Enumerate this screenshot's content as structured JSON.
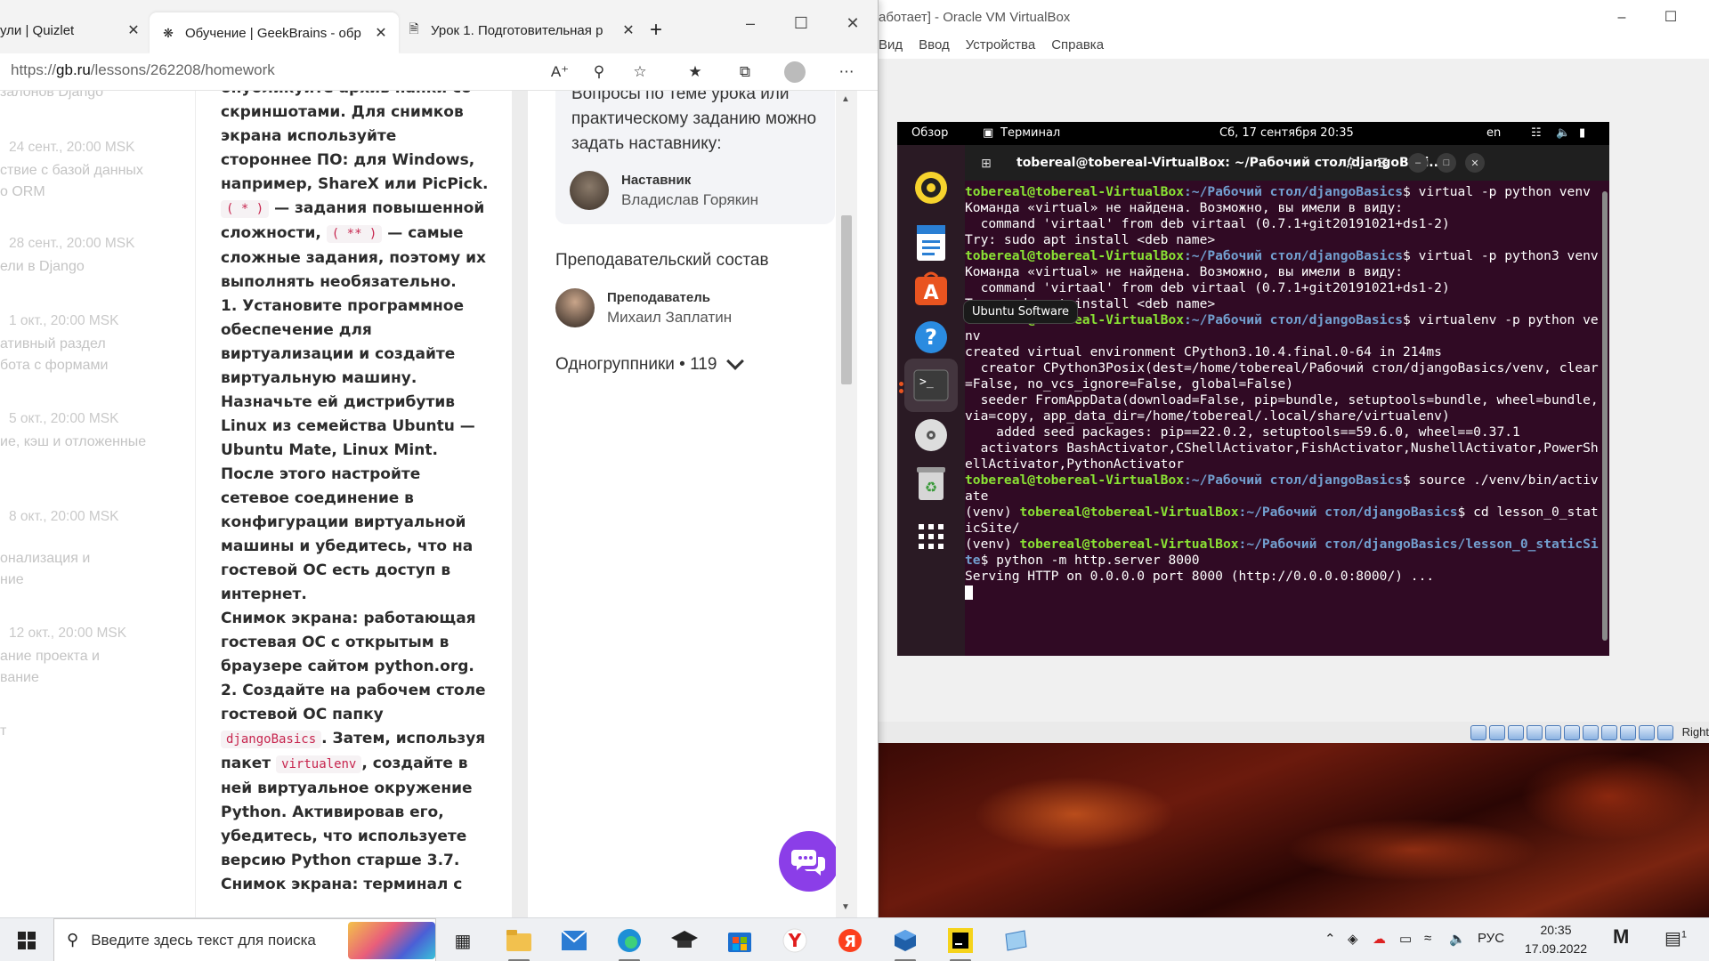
{
  "browser": {
    "tabs": [
      {
        "label": "ули | Quizlet",
        "icon": "quizlet-icon"
      },
      {
        "label": "Обучение | GeekBrains - обр",
        "icon": "openai-like-icon",
        "active": true
      },
      {
        "label": "Урок 1. Подготовительная р",
        "icon": "page-icon"
      }
    ],
    "url_prefix": "https://",
    "url_domain": "gb.ru",
    "url_path": "/lessons/262208/homework"
  },
  "timeline": {
    "top_partial": "залонов Django",
    "items": [
      {
        "date": "24 сент., 20:00 MSK",
        "text": "ствие с базой данных\nо ORM"
      },
      {
        "date": "28 сент., 20:00 MSK",
        "text": "ели в Django"
      },
      {
        "date": "1 окт., 20:00 MSK",
        "text": "ативный раздел\nбота с формами"
      },
      {
        "date": "5 окт., 20:00 MSK",
        "text": "ие, кэш и отложенные"
      },
      {
        "date": "8 окт., 20:00 MSK",
        "text": "онализация и\nние"
      },
      {
        "date": "12 окт., 20:00 MSK",
        "text": "ание проекта и\nвание"
      },
      {
        "date": "",
        "text": "т"
      }
    ]
  },
  "homework": {
    "p1": "опубликуйте архив папки со скриншотами. Для снимков экрана используйте стороннее ПО: для Windows, например, ShareX или PicPick.",
    "code_star": "( * )",
    "p2a": " — задания повышенной сложности, ",
    "code_dstar": "( ** )",
    "p2b": " — самые сложные задания, поэтому их выполнять необязательно.",
    "p3": "1. Установите программное обеспечение для виртуализации и создайте виртуальную машину. Назначьте ей дистрибутив Linux из семейства Ubuntu — Ubuntu Mate, Linux Mint. После этого настройте сетевое соединение в конфигурации виртуальной машины и убедитесь, что на гостевой ОС есть доступ в интернет.",
    "p4": "Снимок экрана: работающая гостевая ОС с открытым в браузере сайтом python.org.",
    "p5a": "2. Создайте на рабочем столе гостевой ОС папку ",
    "code_folder": "djangoBasics",
    "p5b": ". Затем, используя пакет ",
    "code_venv": "virtualenv",
    "p5c": ", создайте в ней виртуальное окружение Python. Активировав его, убедитесь, что используете версию Python старше 3.7.",
    "p6": "Снимок экрана: терминал с"
  },
  "sidebar": {
    "ask_text": "Вопросы по теме урока или практическому заданию можно задать наставнику:",
    "mentor_role": "Наставник",
    "mentor_name": "Владислав Горякин",
    "staff_title": "Преподавательский состав",
    "teacher_role": "Преподаватель",
    "teacher_name": "Михаил Заплатин",
    "group_label": "Одногруппники • 119"
  },
  "vbox": {
    "title": "аботает] - Oracle VM VirtualBox",
    "menu": [
      "Вид",
      "Ввод",
      "Устройства",
      "Справка"
    ],
    "status_key": "Right"
  },
  "ubuntu": {
    "overview": "Обзор",
    "app_name": "Терминал",
    "datetime": "Сб, 17 сентября  20:35",
    "lang": "en",
    "dock_tooltip": "Ubuntu Software",
    "term_title": "tobereal@tobereal-VirtualBox: ~/Рабочий стол/djangoBasi...",
    "lines": [
      {
        "user": "tobereal@tobereal-VirtualBox",
        "path": ":~/Рабочий стол/djangoBasics",
        "cmd": "$ virtual -p python venv"
      },
      {
        "text": "Команда «virtual» не найдена. Возможно, вы имели в виду:"
      },
      {
        "text": "  command 'virtaal' from deb virtaal (0.7.1+git20191021+ds1-2)"
      },
      {
        "text": "Try: sudo apt install <deb name>"
      },
      {
        "user": "tobereal@tobereal-VirtualBox",
        "path": ":~/Рабочий стол/djangoBasics",
        "cmd": "$ virtual -p python3 venv"
      },
      {
        "text": "Команда «virtual» не найдена. Возможно, вы имели в виду:"
      },
      {
        "text": "  command 'virtaal' from deb virtaal (0.7.1+git20191021+ds1-2)"
      },
      {
        "text": "Try: sudo apt install <deb name>"
      },
      {
        "user": "tobereal@tobereal-VirtualBox",
        "path": ":~/Рабочий стол/djangoBasics",
        "cmd": "$ virtualenv -p python venv"
      },
      {
        "text": "created virtual environment CPython3.10.4.final.0-64 in 214ms"
      },
      {
        "text": "  creator CPython3Posix(dest=/home/tobereal/Рабочий стол/djangoBasics/venv, clear=False, no_vcs_ignore=False, global=False)"
      },
      {
        "text": "  seeder FromAppData(download=False, pip=bundle, setuptools=bundle, wheel=bundle, via=copy, app_data_dir=/home/tobereal/.local/share/virtualenv)"
      },
      {
        "text": "    added seed packages: pip==22.0.2, setuptools==59.6.0, wheel==0.37.1"
      },
      {
        "text": "  activators BashActivator,CShellActivator,FishActivator,NushellActivator,PowerShellActivator,PythonActivator"
      },
      {
        "user": "tobereal@tobereal-VirtualBox",
        "path": ":~/Рабочий стол/djangoBasics",
        "cmd": "$ source ./venv/bin/activate"
      },
      {
        "prefix": "(venv) ",
        "user": "tobereal@tobereal-VirtualBox",
        "path": ":~/Рабочий стол/djangoBasics",
        "cmd": "$ cd lesson_0_staticSite/"
      },
      {
        "prefix": "(venv) ",
        "user": "tobereal@tobereal-VirtualBox",
        "path": ":~/Рабочий стол/djangoBasics/lesson_0_staticSite",
        "cmd": "$ python -m http.server 8000"
      },
      {
        "text": "Serving HTTP on 0.0.0.0 port 8000 (http://0.0.0.0:8000/) ..."
      }
    ]
  },
  "taskbar": {
    "search_placeholder": "Введите здесь текст для поиска",
    "lang": "РУС",
    "time": "20:35",
    "date": "17.09.2022",
    "notif_count": "1"
  }
}
